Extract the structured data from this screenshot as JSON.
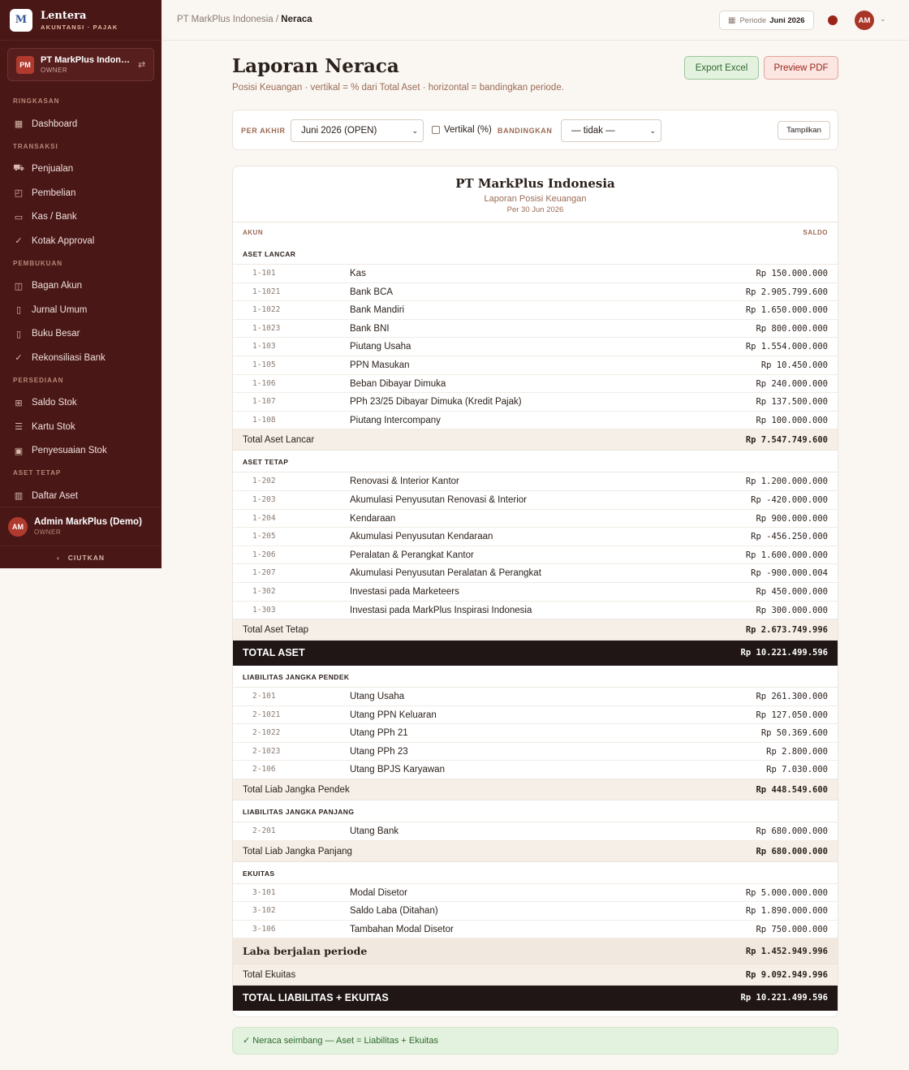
{
  "brand": {
    "logo": "M",
    "name": "Lentera",
    "sub": "AKUNTANSI · PAJAK"
  },
  "company": {
    "badge": "PM",
    "name": "PT MarkPlus Indonesia",
    "role": "OWNER"
  },
  "nav": {
    "sections": [
      {
        "title": "RINGKASAN",
        "items": [
          {
            "label": "Dashboard",
            "icon": "dashboard-icon"
          }
        ]
      },
      {
        "title": "TRANSAKSI",
        "items": [
          {
            "label": "Penjualan",
            "icon": "cart-icon"
          },
          {
            "label": "Pembelian",
            "icon": "bag-icon"
          },
          {
            "label": "Kas / Bank",
            "icon": "wallet-icon"
          },
          {
            "label": "Kotak Approval",
            "icon": "check-icon"
          }
        ]
      },
      {
        "title": "PEMBUKUAN",
        "items": [
          {
            "label": "Bagan Akun",
            "icon": "book-icon"
          },
          {
            "label": "Jurnal Umum",
            "icon": "journal-icon"
          },
          {
            "label": "Buku Besar",
            "icon": "ledger-icon"
          },
          {
            "label": "Rekonsiliasi Bank",
            "icon": "check-icon"
          }
        ]
      },
      {
        "title": "PERSEDIAAN",
        "items": [
          {
            "label": "Saldo Stok",
            "icon": "box-icon"
          },
          {
            "label": "Kartu Stok",
            "icon": "list-icon"
          },
          {
            "label": "Penyesuaian Stok",
            "icon": "clipboard-icon"
          }
        ]
      },
      {
        "title": "ASET TETAP",
        "items": [
          {
            "label": "Daftar Aset",
            "icon": "building-icon"
          }
        ]
      }
    ]
  },
  "user": {
    "initials": "AM",
    "name": "Admin MarkPlus (Demo)",
    "role": "OWNER"
  },
  "collapse_label": "CIUTKAN",
  "topbar": {
    "breadcrumb_parent": "PT MarkPlus Indonesia",
    "breadcrumb_sep": " / ",
    "breadcrumb_current": "Neraca",
    "period_label": "Periode",
    "period_value": "Juni 2026",
    "avatar": "AM"
  },
  "page": {
    "title": "Laporan Neraca",
    "subtitle": "Posisi Keuangan · vertikal = % dari Total Aset · horizontal = bandingkan periode.",
    "export_excel": "Export Excel",
    "preview_pdf": "Preview PDF"
  },
  "filter": {
    "per_akhir_label": "PER AKHIR",
    "per_akhir_value": "Juni 2026 (OPEN)",
    "vertikal_label": "Vertikal (%)",
    "bandingkan_label": "BANDINGKAN",
    "bandingkan_value": "— tidak —",
    "tampilkan": "Tampilkan"
  },
  "report": {
    "company": "PT MarkPlus Indonesia",
    "title": "Laporan Posisi Keuangan",
    "date": "Per 30 Jun 2026",
    "col_akun": "AKUN",
    "col_saldo": "SALDO",
    "blocks": [
      {
        "kind": "section",
        "title": "ASET LANCAR"
      },
      {
        "kind": "row",
        "code": "1-101",
        "name": "Kas",
        "amount": "Rp 150.000.000"
      },
      {
        "kind": "row",
        "code": "1-1021",
        "name": "Bank BCA",
        "amount": "Rp 2.905.799.600"
      },
      {
        "kind": "row",
        "code": "1-1022",
        "name": "Bank Mandiri",
        "amount": "Rp 1.650.000.000"
      },
      {
        "kind": "row",
        "code": "1-1023",
        "name": "Bank BNI",
        "amount": "Rp 800.000.000"
      },
      {
        "kind": "row",
        "code": "1-103",
        "name": "Piutang Usaha",
        "amount": "Rp 1.554.000.000"
      },
      {
        "kind": "row",
        "code": "1-105",
        "name": "PPN Masukan",
        "amount": "Rp 10.450.000"
      },
      {
        "kind": "row",
        "code": "1-106",
        "name": "Beban Dibayar Dimuka",
        "amount": "Rp 240.000.000"
      },
      {
        "kind": "row",
        "code": "1-107",
        "name": "PPh 23/25 Dibayar Dimuka (Kredit Pajak)",
        "amount": "Rp 137.500.000"
      },
      {
        "kind": "row",
        "code": "1-108",
        "name": "Piutang Intercompany",
        "amount": "Rp 100.000.000"
      },
      {
        "kind": "subtotal",
        "name": "Total Aset Lancar",
        "amount": "Rp 7.547.749.600"
      },
      {
        "kind": "section",
        "title": "ASET TETAP"
      },
      {
        "kind": "row",
        "code": "1-202",
        "name": "Renovasi & Interior Kantor",
        "amount": "Rp 1.200.000.000"
      },
      {
        "kind": "row",
        "code": "1-203",
        "name": "Akumulasi Penyusutan Renovasi & Interior",
        "amount": "Rp -420.000.000"
      },
      {
        "kind": "row",
        "code": "1-204",
        "name": "Kendaraan",
        "amount": "Rp 900.000.000"
      },
      {
        "kind": "row",
        "code": "1-205",
        "name": "Akumulasi Penyusutan Kendaraan",
        "amount": "Rp -456.250.000"
      },
      {
        "kind": "row",
        "code": "1-206",
        "name": "Peralatan & Perangkat Kantor",
        "amount": "Rp 1.600.000.000"
      },
      {
        "kind": "row",
        "code": "1-207",
        "name": "Akumulasi Penyusutan Peralatan & Perangkat",
        "amount": "Rp -900.000.004"
      },
      {
        "kind": "row",
        "code": "1-302",
        "name": "Investasi pada Marketeers",
        "amount": "Rp 450.000.000"
      },
      {
        "kind": "row",
        "code": "1-303",
        "name": "Investasi pada MarkPlus Inspirasi Indonesia",
        "amount": "Rp 300.000.000"
      },
      {
        "kind": "subtotal",
        "name": "Total Aset Tetap",
        "amount": "Rp 2.673.749.996"
      },
      {
        "kind": "grand",
        "name": "TOTAL ASET",
        "amount": "Rp 10.221.499.596"
      },
      {
        "kind": "section",
        "title": "LIABILITAS JANGKA PENDEK"
      },
      {
        "kind": "row",
        "code": "2-101",
        "name": "Utang Usaha",
        "amount": "Rp 261.300.000"
      },
      {
        "kind": "row",
        "code": "2-1021",
        "name": "Utang PPN Keluaran",
        "amount": "Rp 127.050.000"
      },
      {
        "kind": "row",
        "code": "2-1022",
        "name": "Utang PPh 21",
        "amount": "Rp 50.369.600"
      },
      {
        "kind": "row",
        "code": "2-1023",
        "name": "Utang PPh 23",
        "amount": "Rp 2.800.000"
      },
      {
        "kind": "row",
        "code": "2-106",
        "name": "Utang BPJS Karyawan",
        "amount": "Rp 7.030.000"
      },
      {
        "kind": "subtotal",
        "name": "Total Liab Jangka Pendek",
        "amount": "Rp 448.549.600"
      },
      {
        "kind": "section",
        "title": "LIABILITAS JANGKA PANJANG"
      },
      {
        "kind": "row",
        "code": "2-201",
        "name": "Utang Bank",
        "amount": "Rp 680.000.000"
      },
      {
        "kind": "subtotal",
        "name": "Total Liab Jangka Panjang",
        "amount": "Rp 680.000.000"
      },
      {
        "kind": "section",
        "title": "EKUITAS"
      },
      {
        "kind": "row",
        "code": "3-101",
        "name": "Modal Disetor",
        "amount": "Rp 5.000.000.000"
      },
      {
        "kind": "row",
        "code": "3-102",
        "name": "Saldo Laba (Ditahan)",
        "amount": "Rp 1.890.000.000"
      },
      {
        "kind": "row",
        "code": "3-106",
        "name": "Tambahan Modal Disetor",
        "amount": "Rp 750.000.000"
      },
      {
        "kind": "laba",
        "name": "Laba berjalan periode",
        "amount": "Rp 1.452.949.996"
      },
      {
        "kind": "subtotal",
        "name": "Total Ekuitas",
        "amount": "Rp 9.092.949.996"
      },
      {
        "kind": "grand",
        "name": "TOTAL LIABILITAS + EKUITAS",
        "amount": "Rp 10.221.499.596"
      }
    ]
  },
  "balance_note": "✓ Neraca seimbang — Aset = Liabilitas + Ekuitas"
}
